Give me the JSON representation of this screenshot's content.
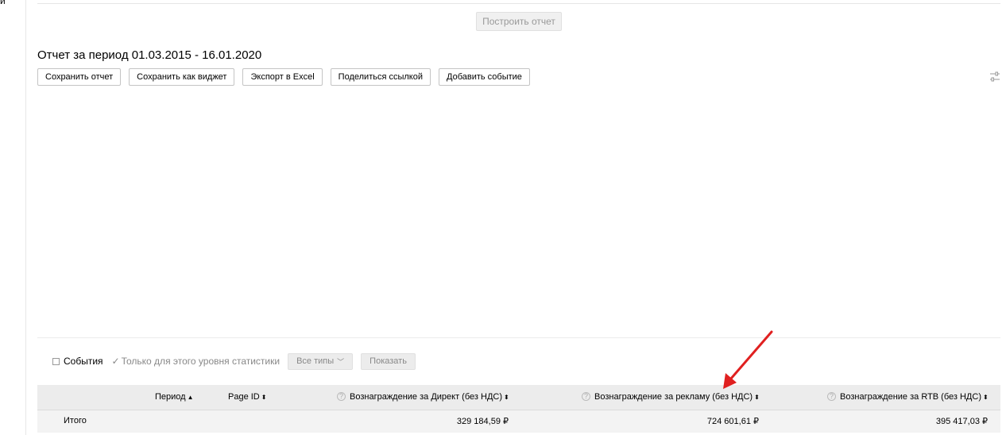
{
  "left_edge_text": "и",
  "toolbar": {
    "build_report_label": "Построить отчет",
    "report_title": "Отчет за период 01.03.2015 - 16.01.2020",
    "buttons": [
      {
        "label": "Сохранить отчет"
      },
      {
        "label": "Сохранить как виджет"
      },
      {
        "label": "Экспорт в Excel"
      },
      {
        "label": "Поделиться ссылкой"
      },
      {
        "label": "Добавить событие"
      }
    ],
    "settings_icon": "sliders-icon"
  },
  "filters": {
    "events_label": "События",
    "events_checked": false,
    "level_only_label": "Только для этого уровня статистики",
    "level_only_checked": true,
    "types_select": "Все типы",
    "show_button": "Показать"
  },
  "table": {
    "columns": [
      {
        "label": "Период",
        "sort": "▲"
      },
      {
        "label": "Page ID",
        "sort": "⬍"
      },
      {
        "label": "Вознаграждение за Директ (без НДС)",
        "sort": "⬍",
        "help_icon": true
      },
      {
        "label": "Вознаграждение за рекламу (без НДС)",
        "sort": "⬍",
        "help_icon": true
      },
      {
        "label": "Вознаграждение за RTB (без НДС)",
        "sort": "⬍",
        "help_icon": true
      }
    ],
    "total_row": {
      "label": "Итого",
      "direct": "329 184,59 ₽",
      "ads": "724 601,61 ₽",
      "rtb": "395 417,03 ₽"
    }
  },
  "colors": {
    "annotation_arrow": "#e02020",
    "header_bg": "#ececec",
    "total_bg": "#f3f3f3"
  }
}
